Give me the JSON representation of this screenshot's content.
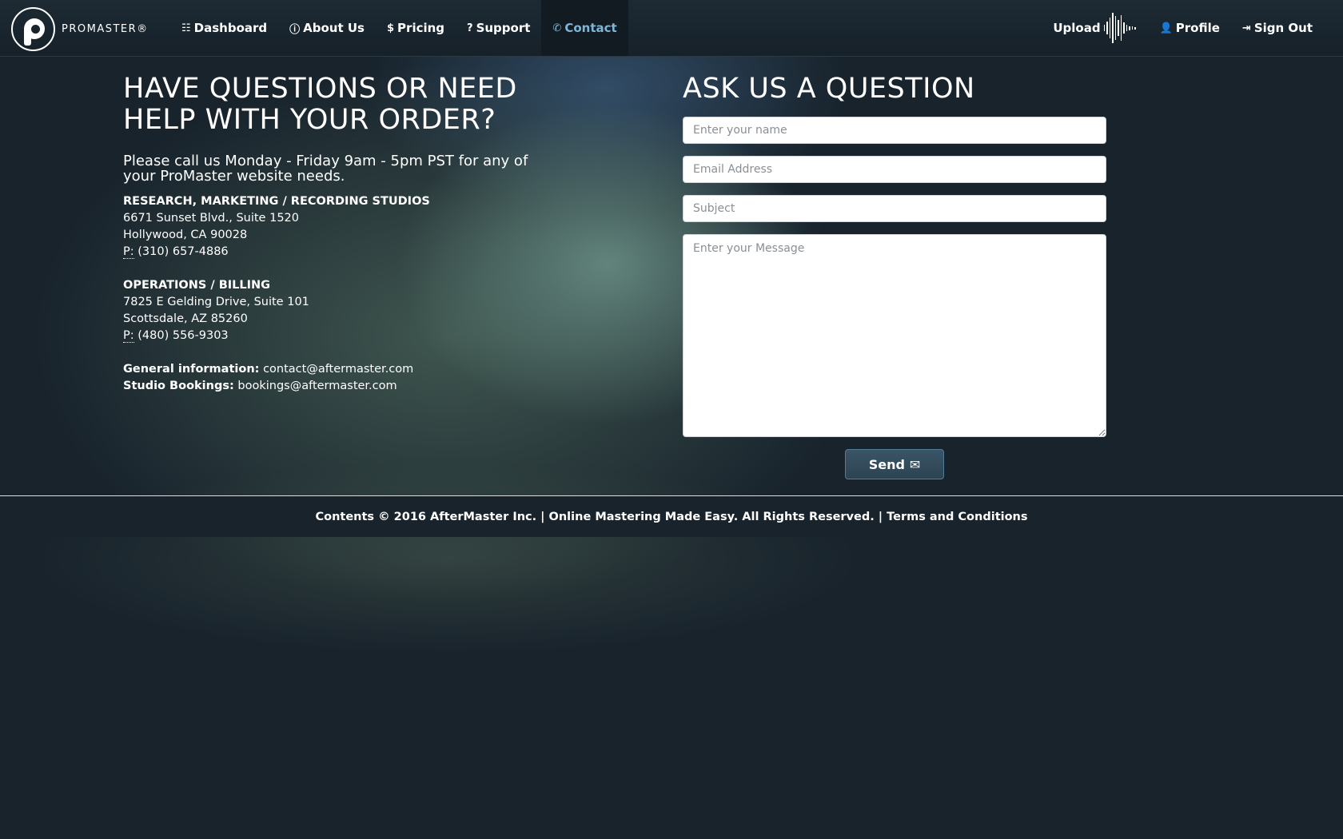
{
  "brand": {
    "name": "PROMASTER®"
  },
  "nav": {
    "items": [
      {
        "icon": "sliders-icon",
        "glyph": "☷",
        "label": "Dashboard"
      },
      {
        "icon": "info-circle-icon",
        "glyph": "ⓘ",
        "label": "About Us"
      },
      {
        "icon": "dollar-icon",
        "glyph": "$",
        "label": "Pricing"
      },
      {
        "icon": "question-circle-icon",
        "glyph": "?",
        "label": "Support"
      },
      {
        "icon": "phone-icon",
        "glyph": "✆",
        "label": "Contact",
        "active": true
      }
    ],
    "right": {
      "upload_label": "Upload",
      "profile_label": "Profile",
      "signout_label": "Sign Out"
    }
  },
  "left": {
    "heading": "HAVE QUESTIONS OR NEED HELP WITH YOUR ORDER?",
    "intro": "Please call us Monday - Friday 9am - 5pm PST for any of your ProMaster website needs.",
    "offices": [
      {
        "title": "RESEARCH, MARKETING / RECORDING STUDIOS",
        "line1": "6671 Sunset Blvd., Suite 1520",
        "line2": "Hollywood, CA 90028",
        "phone_prefix": "P:",
        "phone": "(310) 657-4886"
      },
      {
        "title": "OPERATIONS / BILLING",
        "line1": "7825 E Gelding Drive, Suite 101",
        "line2": "Scottsdale, AZ 85260",
        "phone_prefix": "P:",
        "phone": "(480) 556-9303"
      }
    ],
    "general_label": "General information:",
    "general_email": "contact@aftermaster.com",
    "bookings_label": "Studio Bookings:",
    "bookings_email": "bookings@aftermaster.com"
  },
  "form": {
    "heading": "ASK US A QUESTION",
    "name_placeholder": "Enter your name",
    "email_placeholder": "Email Address",
    "subject_placeholder": "Subject",
    "message_placeholder": "Enter your Message",
    "send_label": "Send",
    "send_icon": "envelope-icon"
  },
  "footer": {
    "text": "Contents © 2016 AfterMaster Inc. | Online Mastering Made Easy. All Rights Reserved. |",
    "terms_link": "Terms and Conditions"
  },
  "colors": {
    "background": "#18232c",
    "active_nav": "#7fb6d8",
    "button": "#2c4352"
  }
}
